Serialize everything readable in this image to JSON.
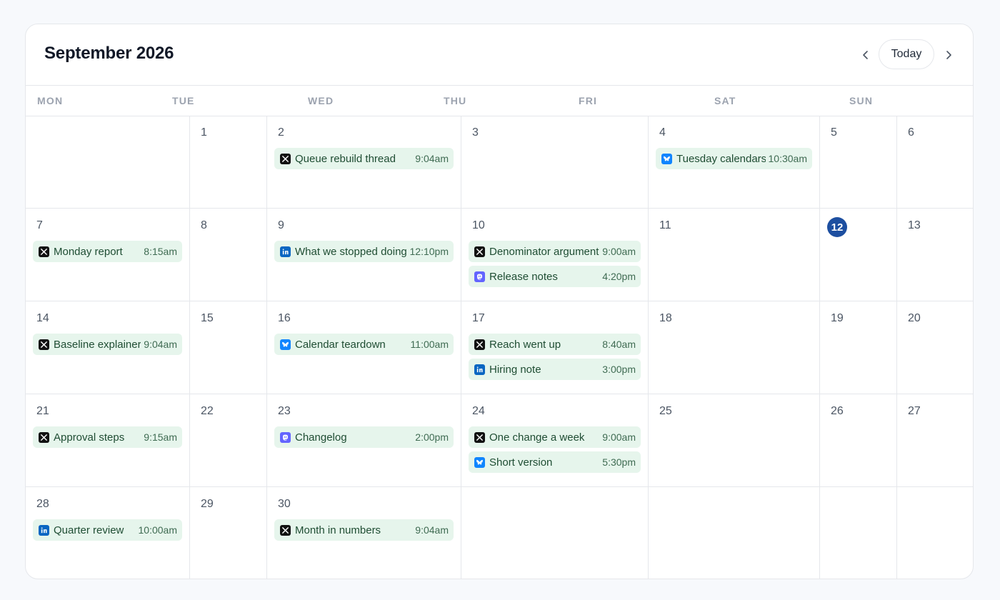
{
  "header": {
    "title": "September 2026",
    "today_label": "Today"
  },
  "weekdays": [
    "MON",
    "TUE",
    "WED",
    "THU",
    "FRI",
    "SAT",
    "SUN"
  ],
  "today": 12,
  "weeks": [
    [
      {
        "day": "",
        "events": []
      },
      {
        "day": "1",
        "events": []
      },
      {
        "day": "2",
        "events": [
          {
            "platform": "x",
            "title": "Queue rebuild thread",
            "time": "9:04am"
          }
        ]
      },
      {
        "day": "3",
        "events": []
      },
      {
        "day": "4",
        "events": [
          {
            "platform": "bluesky",
            "title": "Tuesday calendars",
            "time": "10:30am"
          }
        ]
      },
      {
        "day": "5",
        "events": []
      },
      {
        "day": "6",
        "events": []
      }
    ],
    [
      {
        "day": "7",
        "events": [
          {
            "platform": "x",
            "title": "Monday report",
            "time": "8:15am"
          }
        ]
      },
      {
        "day": "8",
        "events": []
      },
      {
        "day": "9",
        "events": [
          {
            "platform": "linkedin",
            "title": "What we stopped doing",
            "time": "12:10pm"
          }
        ]
      },
      {
        "day": "10",
        "events": [
          {
            "platform": "x",
            "title": "Denominator argument",
            "time": "9:00am"
          },
          {
            "platform": "mastodon",
            "title": "Release notes",
            "time": "4:20pm"
          }
        ]
      },
      {
        "day": "11",
        "events": []
      },
      {
        "day": "12",
        "events": []
      },
      {
        "day": "13",
        "events": []
      }
    ],
    [
      {
        "day": "14",
        "events": [
          {
            "platform": "x",
            "title": "Baseline explainer",
            "time": "9:04am"
          }
        ]
      },
      {
        "day": "15",
        "events": []
      },
      {
        "day": "16",
        "events": [
          {
            "platform": "bluesky",
            "title": "Calendar teardown",
            "time": "11:00am"
          }
        ]
      },
      {
        "day": "17",
        "events": [
          {
            "platform": "x",
            "title": "Reach went up",
            "time": "8:40am"
          },
          {
            "platform": "linkedin",
            "title": "Hiring note",
            "time": "3:00pm"
          }
        ]
      },
      {
        "day": "18",
        "events": []
      },
      {
        "day": "19",
        "events": []
      },
      {
        "day": "20",
        "events": []
      }
    ],
    [
      {
        "day": "21",
        "events": [
          {
            "platform": "x",
            "title": "Approval steps",
            "time": "9:15am"
          }
        ]
      },
      {
        "day": "22",
        "events": []
      },
      {
        "day": "23",
        "events": [
          {
            "platform": "mastodon",
            "title": "Changelog",
            "time": "2:00pm"
          }
        ]
      },
      {
        "day": "24",
        "events": [
          {
            "platform": "x",
            "title": "One change a week",
            "time": "9:00am"
          },
          {
            "platform": "bluesky",
            "title": "Short version",
            "time": "5:30pm"
          }
        ]
      },
      {
        "day": "25",
        "events": []
      },
      {
        "day": "26",
        "events": []
      },
      {
        "day": "27",
        "events": []
      }
    ],
    [
      {
        "day": "28",
        "events": [
          {
            "platform": "linkedin",
            "title": "Quarter review",
            "time": "10:00am"
          }
        ]
      },
      {
        "day": "29",
        "events": []
      },
      {
        "day": "30",
        "events": [
          {
            "platform": "x",
            "title": "Month in numbers",
            "time": "9:04am"
          }
        ]
      },
      {
        "day": "",
        "events": []
      },
      {
        "day": "",
        "events": []
      },
      {
        "day": "",
        "events": []
      },
      {
        "day": "",
        "events": []
      }
    ]
  ],
  "platform_icons": {
    "x": {
      "icon": "x-logo-icon",
      "color": "#111111"
    },
    "linkedin": {
      "icon": "linkedin-logo-icon",
      "color": "#0a66c2"
    },
    "bluesky": {
      "icon": "bluesky-logo-icon",
      "color": "#1185fe"
    },
    "mastodon": {
      "icon": "mastodon-logo-icon",
      "color": "#6364ff"
    }
  },
  "colors": {
    "event_bg": "#e6f5ec",
    "today_badge": "#1d4fa0"
  }
}
